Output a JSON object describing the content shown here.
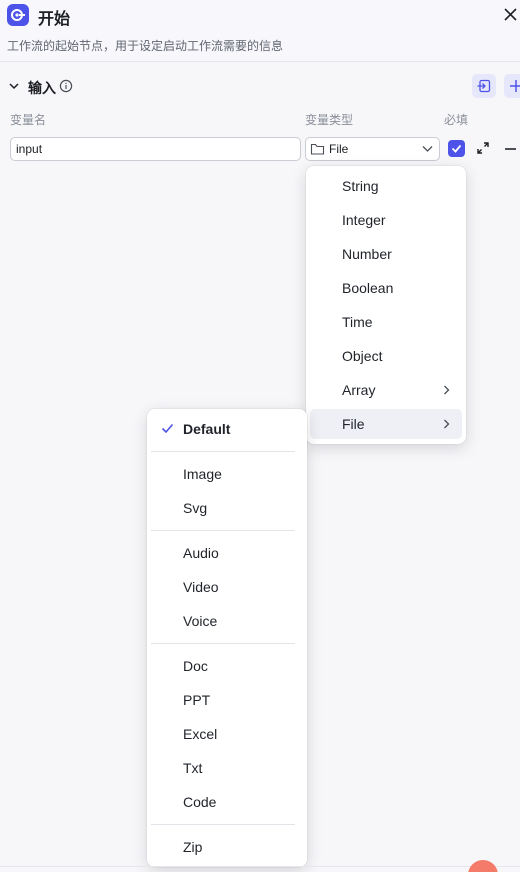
{
  "header": {
    "title": "开始",
    "description": "工作流的起始节点，用于设定启动工作流需要的信息"
  },
  "section": {
    "title": "输入"
  },
  "columns": {
    "name": "变量名",
    "type": "变量类型",
    "required": "必填"
  },
  "row": {
    "name_value": "input",
    "type_value": "File",
    "required_checked": true
  },
  "type_menu": {
    "items": [
      "String",
      "Integer",
      "Number",
      "Boolean",
      "Time",
      "Object",
      "Array",
      "File"
    ],
    "active": "File"
  },
  "file_submenu": {
    "groups": [
      [
        "Default"
      ],
      [
        "Image",
        "Svg"
      ],
      [
        "Audio",
        "Video",
        "Voice"
      ],
      [
        "Doc",
        "PPT",
        "Excel",
        "Txt",
        "Code"
      ],
      [
        "Zip"
      ]
    ],
    "selected": "Default"
  },
  "colors": {
    "accent": "#4d53e8",
    "accent_light": "#e6e7fb",
    "fab": "#f47a6a"
  }
}
